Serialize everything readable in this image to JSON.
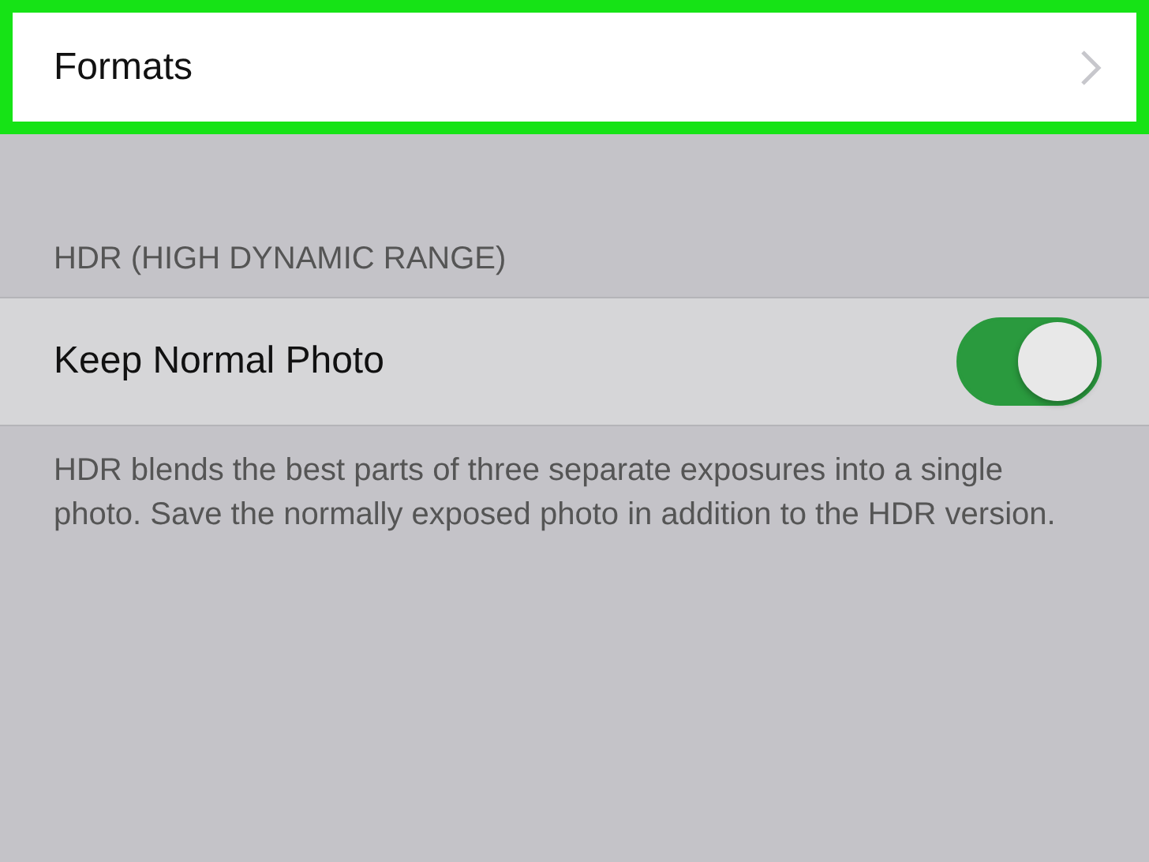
{
  "formats_row": {
    "label": "Formats",
    "highlighted": true
  },
  "hdr_section": {
    "header": "HDR (HIGH DYNAMIC RANGE)",
    "rows": [
      {
        "kind": "toggle",
        "label": "Keep Normal Photo",
        "on": true
      }
    ],
    "footer": "HDR blends the best parts of three separate exposures into a single photo. Save the normally exposed photo in addition to the HDR version."
  }
}
